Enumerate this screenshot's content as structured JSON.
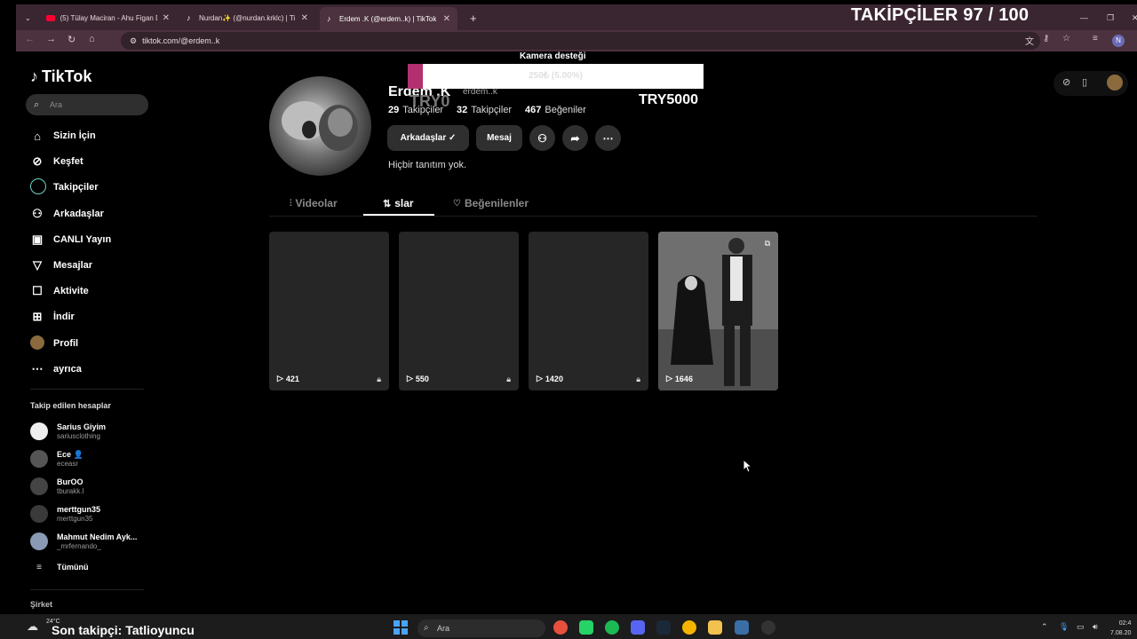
{
  "browser": {
    "tabs": [
      {
        "title": "(5) Tülay Maciran - Ahu Figan D",
        "favicon": "youtube-icon"
      },
      {
        "title": "Nurdan✨ (@nurdan.krklc) | Ti",
        "favicon": "tiktok-icon"
      },
      {
        "title": "Erdem .K (@erdem..k) | TikTok",
        "favicon": "tiktok-icon"
      }
    ],
    "url": "tiktok.com/@erdem..k",
    "profile_initial": "N"
  },
  "overlay": {
    "follower_goal": "TAKİPÇİLER 97 / 100",
    "camera_label": "Kamera desteği",
    "goal_progress_text": "250₺ (5.00%)",
    "goal_progress": 0.05,
    "goal_min": "TRY0",
    "goal_max": "TRY5000",
    "last_follower": "Son takipçi: Tatlioyuncu",
    "weather_temp": "24°C"
  },
  "sidebar": {
    "logo": "TikTok",
    "search_placeholder": "Ara",
    "nav": [
      {
        "label": "Sizin İçin",
        "icon": "home-icon"
      },
      {
        "label": "Keşfet",
        "icon": "compass-icon"
      },
      {
        "label": "Takipçiler",
        "icon": "following-ring-icon"
      },
      {
        "label": "Arkadaşlar",
        "icon": "friends-icon"
      },
      {
        "label": "CANLI Yayın",
        "icon": "live-icon"
      },
      {
        "label": "Mesajlar",
        "icon": "send-icon"
      },
      {
        "label": "Aktivite",
        "icon": "activity-icon"
      },
      {
        "label": "İndir",
        "icon": "download-icon"
      },
      {
        "label": "Profil",
        "icon": "avatar-icon"
      },
      {
        "label": "ayrıca",
        "icon": "more-icon"
      }
    ],
    "following_title": "Takip edilen hesaplar",
    "following": [
      {
        "name": "Sarius Giyim",
        "handle": "sariusclothing"
      },
      {
        "name": "Ece 👤",
        "handle": "eceasr"
      },
      {
        "name": "BurOO",
        "handle": "tburakk.l"
      },
      {
        "name": "merttgun35",
        "handle": "merttgun35"
      },
      {
        "name": "Mahmut Nedim Ayk...",
        "handle": "_mrfernando_"
      }
    ],
    "see_all": "Tümünü",
    "company": "Şirket"
  },
  "profile": {
    "name": "Erdem .K",
    "username": "erdem..k",
    "stats": [
      {
        "value": "29",
        "label": "Takipçiler"
      },
      {
        "value": "32",
        "label": "Takipçiler"
      },
      {
        "value": "467",
        "label": "Beğeniler"
      }
    ],
    "buttons": {
      "friends": "Arkadaşlar ✓",
      "message": "Mesaj"
    },
    "bio": "Hiçbir tanıtım yok.",
    "tabs": [
      {
        "label": "Videolar",
        "icon": "grid-icon"
      },
      {
        "label": "slar",
        "icon": "repost-icon"
      },
      {
        "label": "Beğenilenler",
        "icon": "heart-icon"
      }
    ],
    "videos": [
      {
        "views": "421"
      },
      {
        "views": "550"
      },
      {
        "views": "1420"
      },
      {
        "views": "1646"
      }
    ]
  },
  "taskbar": {
    "search_placeholder": "Ara",
    "time": "02:4",
    "date": "7.08.20"
  }
}
